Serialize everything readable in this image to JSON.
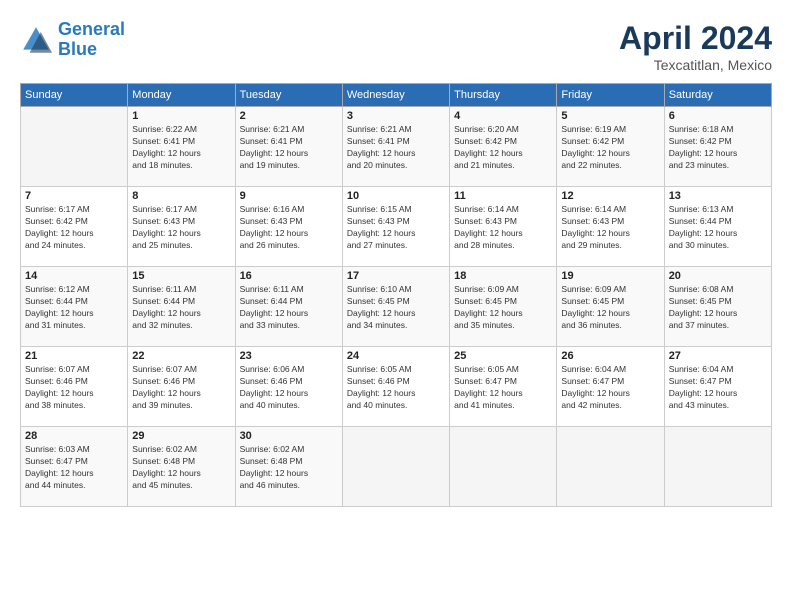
{
  "logo": {
    "line1": "General",
    "line2": "Blue"
  },
  "title": "April 2024",
  "location": "Texcatitlan, Mexico",
  "days_header": [
    "Sunday",
    "Monday",
    "Tuesday",
    "Wednesday",
    "Thursday",
    "Friday",
    "Saturday"
  ],
  "weeks": [
    [
      {
        "num": "",
        "sunrise": "",
        "sunset": "",
        "daylight": ""
      },
      {
        "num": "1",
        "sunrise": "Sunrise: 6:22 AM",
        "sunset": "Sunset: 6:41 PM",
        "daylight": "Daylight: 12 hours and 18 minutes."
      },
      {
        "num": "2",
        "sunrise": "Sunrise: 6:21 AM",
        "sunset": "Sunset: 6:41 PM",
        "daylight": "Daylight: 12 hours and 19 minutes."
      },
      {
        "num": "3",
        "sunrise": "Sunrise: 6:21 AM",
        "sunset": "Sunset: 6:41 PM",
        "daylight": "Daylight: 12 hours and 20 minutes."
      },
      {
        "num": "4",
        "sunrise": "Sunrise: 6:20 AM",
        "sunset": "Sunset: 6:42 PM",
        "daylight": "Daylight: 12 hours and 21 minutes."
      },
      {
        "num": "5",
        "sunrise": "Sunrise: 6:19 AM",
        "sunset": "Sunset: 6:42 PM",
        "daylight": "Daylight: 12 hours and 22 minutes."
      },
      {
        "num": "6",
        "sunrise": "Sunrise: 6:18 AM",
        "sunset": "Sunset: 6:42 PM",
        "daylight": "Daylight: 12 hours and 23 minutes."
      }
    ],
    [
      {
        "num": "7",
        "sunrise": "Sunrise: 6:17 AM",
        "sunset": "Sunset: 6:42 PM",
        "daylight": "Daylight: 12 hours and 24 minutes."
      },
      {
        "num": "8",
        "sunrise": "Sunrise: 6:17 AM",
        "sunset": "Sunset: 6:43 PM",
        "daylight": "Daylight: 12 hours and 25 minutes."
      },
      {
        "num": "9",
        "sunrise": "Sunrise: 6:16 AM",
        "sunset": "Sunset: 6:43 PM",
        "daylight": "Daylight: 12 hours and 26 minutes."
      },
      {
        "num": "10",
        "sunrise": "Sunrise: 6:15 AM",
        "sunset": "Sunset: 6:43 PM",
        "daylight": "Daylight: 12 hours and 27 minutes."
      },
      {
        "num": "11",
        "sunrise": "Sunrise: 6:14 AM",
        "sunset": "Sunset: 6:43 PM",
        "daylight": "Daylight: 12 hours and 28 minutes."
      },
      {
        "num": "12",
        "sunrise": "Sunrise: 6:14 AM",
        "sunset": "Sunset: 6:43 PM",
        "daylight": "Daylight: 12 hours and 29 minutes."
      },
      {
        "num": "13",
        "sunrise": "Sunrise: 6:13 AM",
        "sunset": "Sunset: 6:44 PM",
        "daylight": "Daylight: 12 hours and 30 minutes."
      }
    ],
    [
      {
        "num": "14",
        "sunrise": "Sunrise: 6:12 AM",
        "sunset": "Sunset: 6:44 PM",
        "daylight": "Daylight: 12 hours and 31 minutes."
      },
      {
        "num": "15",
        "sunrise": "Sunrise: 6:11 AM",
        "sunset": "Sunset: 6:44 PM",
        "daylight": "Daylight: 12 hours and 32 minutes."
      },
      {
        "num": "16",
        "sunrise": "Sunrise: 6:11 AM",
        "sunset": "Sunset: 6:44 PM",
        "daylight": "Daylight: 12 hours and 33 minutes."
      },
      {
        "num": "17",
        "sunrise": "Sunrise: 6:10 AM",
        "sunset": "Sunset: 6:45 PM",
        "daylight": "Daylight: 12 hours and 34 minutes."
      },
      {
        "num": "18",
        "sunrise": "Sunrise: 6:09 AM",
        "sunset": "Sunset: 6:45 PM",
        "daylight": "Daylight: 12 hours and 35 minutes."
      },
      {
        "num": "19",
        "sunrise": "Sunrise: 6:09 AM",
        "sunset": "Sunset: 6:45 PM",
        "daylight": "Daylight: 12 hours and 36 minutes."
      },
      {
        "num": "20",
        "sunrise": "Sunrise: 6:08 AM",
        "sunset": "Sunset: 6:45 PM",
        "daylight": "Daylight: 12 hours and 37 minutes."
      }
    ],
    [
      {
        "num": "21",
        "sunrise": "Sunrise: 6:07 AM",
        "sunset": "Sunset: 6:46 PM",
        "daylight": "Daylight: 12 hours and 38 minutes."
      },
      {
        "num": "22",
        "sunrise": "Sunrise: 6:07 AM",
        "sunset": "Sunset: 6:46 PM",
        "daylight": "Daylight: 12 hours and 39 minutes."
      },
      {
        "num": "23",
        "sunrise": "Sunrise: 6:06 AM",
        "sunset": "Sunset: 6:46 PM",
        "daylight": "Daylight: 12 hours and 40 minutes."
      },
      {
        "num": "24",
        "sunrise": "Sunrise: 6:05 AM",
        "sunset": "Sunset: 6:46 PM",
        "daylight": "Daylight: 12 hours and 40 minutes."
      },
      {
        "num": "25",
        "sunrise": "Sunrise: 6:05 AM",
        "sunset": "Sunset: 6:47 PM",
        "daylight": "Daylight: 12 hours and 41 minutes."
      },
      {
        "num": "26",
        "sunrise": "Sunrise: 6:04 AM",
        "sunset": "Sunset: 6:47 PM",
        "daylight": "Daylight: 12 hours and 42 minutes."
      },
      {
        "num": "27",
        "sunrise": "Sunrise: 6:04 AM",
        "sunset": "Sunset: 6:47 PM",
        "daylight": "Daylight: 12 hours and 43 minutes."
      }
    ],
    [
      {
        "num": "28",
        "sunrise": "Sunrise: 6:03 AM",
        "sunset": "Sunset: 6:47 PM",
        "daylight": "Daylight: 12 hours and 44 minutes."
      },
      {
        "num": "29",
        "sunrise": "Sunrise: 6:02 AM",
        "sunset": "Sunset: 6:48 PM",
        "daylight": "Daylight: 12 hours and 45 minutes."
      },
      {
        "num": "30",
        "sunrise": "Sunrise: 6:02 AM",
        "sunset": "Sunset: 6:48 PM",
        "daylight": "Daylight: 12 hours and 46 minutes."
      },
      {
        "num": "",
        "sunrise": "",
        "sunset": "",
        "daylight": ""
      },
      {
        "num": "",
        "sunrise": "",
        "sunset": "",
        "daylight": ""
      },
      {
        "num": "",
        "sunrise": "",
        "sunset": "",
        "daylight": ""
      },
      {
        "num": "",
        "sunrise": "",
        "sunset": "",
        "daylight": ""
      }
    ]
  ]
}
